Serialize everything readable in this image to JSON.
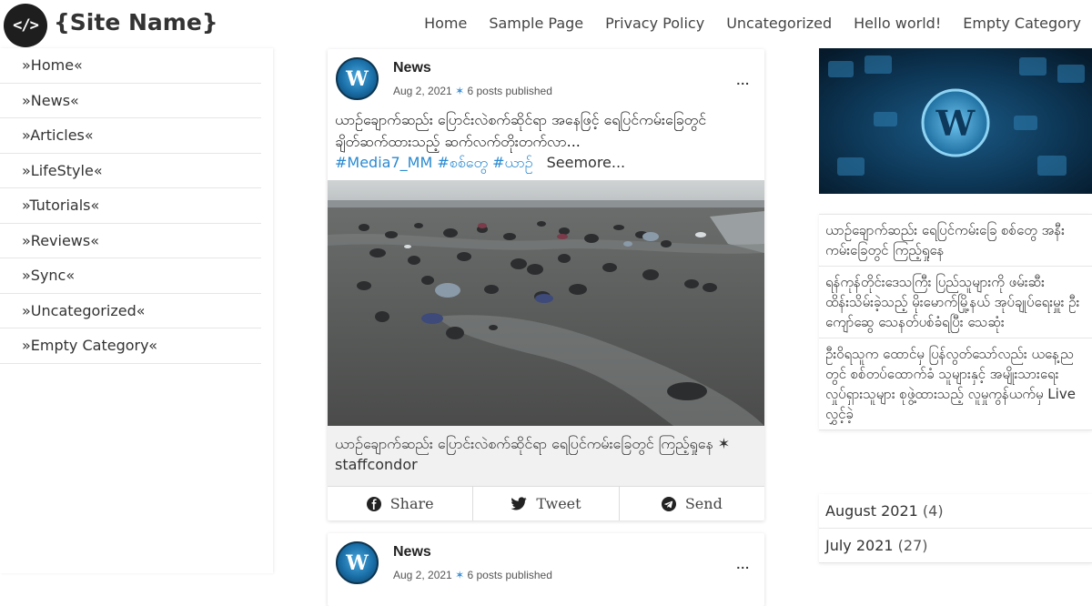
{
  "header": {
    "logo_text": "</>",
    "site_name": "{Site Name}",
    "nav": [
      "Home",
      "Sample Page",
      "Privacy Policy",
      "Uncategorized",
      "Hello world!",
      "Empty Category"
    ]
  },
  "sidebar_left": {
    "categories": [
      "»Home«",
      "»News«",
      "»Articles«",
      "»LifeStyle«",
      "»Tutorials«",
      "»Reviews«",
      "»Sync«",
      "»Uncategorized«",
      "»Empty Category«"
    ]
  },
  "post1": {
    "author": "News",
    "date": "Aug 2, 2021",
    "separator": "✶",
    "posts_published": "6 posts published",
    "more": "...",
    "text": "ယာဉ်ချောက်ဆည်း ပြောင်းလဲစက်ဆိုင်ရာ အနေဖြင့် ရေပြင်ကမ်းခြေတွင် ချိတ်ဆက်ထားသည့် ဆက်လက်တိုးတက်လာ...",
    "tags": [
      "#Media7_MM",
      "#စစ်တွေ",
      "#ယာဉ်"
    ],
    "seemore": "Seemore...",
    "caption": "ယာဉ်ချောက်ဆည်း ပြောင်းလဲစက်ဆိုင်ရာ ရေပြင်ကမ်းခြေတွင် ကြည့်ရှုနေ ✶ staffcondor",
    "share": {
      "label": "Share",
      "icon": "facebook-icon"
    },
    "tweet": {
      "label": "Tweet",
      "icon": "twitter-icon"
    },
    "send": {
      "label": "Send",
      "icon": "telegram-icon"
    }
  },
  "post2": {
    "author": "News",
    "date": "Aug 2, 2021",
    "separator": "✶",
    "posts_published": "6 posts published",
    "more": "..."
  },
  "sidebar_right": {
    "recent": [
      "ယာဉ်ချောက်ဆည်း ရေပြင်ကမ်းခြေ စစ်တွေ အနီးကမ်းခြေတွင် ကြည့်ရှုနေ",
      "ရန်ကုန်တိုင်းဒေသကြီး ပြည်သူများကို ဖမ်းဆီးထိန်းသိမ်းခဲ့သည့် မိုးမောက်မြို့နယ် အုပ်ချုပ်ရေးမှူး ဦးကျော်ဆွေ သေနတ်ပစ်ခံရပြီး သေဆုံး",
      "ဦးဝိရသူက ထောင်မှ ပြန်လွတ်သော်လည်း ယနေ့ညတွင် စစ်တပ်ထောက်ခံ သူများနှင့် အမျိုးသားရေး လှုပ်ရှားသူများ စုဖွဲ့ထားသည့် လူမှုကွန်ယက်မှ Live လွှင့်ခဲ့"
    ],
    "archives": [
      {
        "label": "August 2021",
        "count": "(4)"
      },
      {
        "label": "July 2021",
        "count": "(27)"
      }
    ]
  }
}
